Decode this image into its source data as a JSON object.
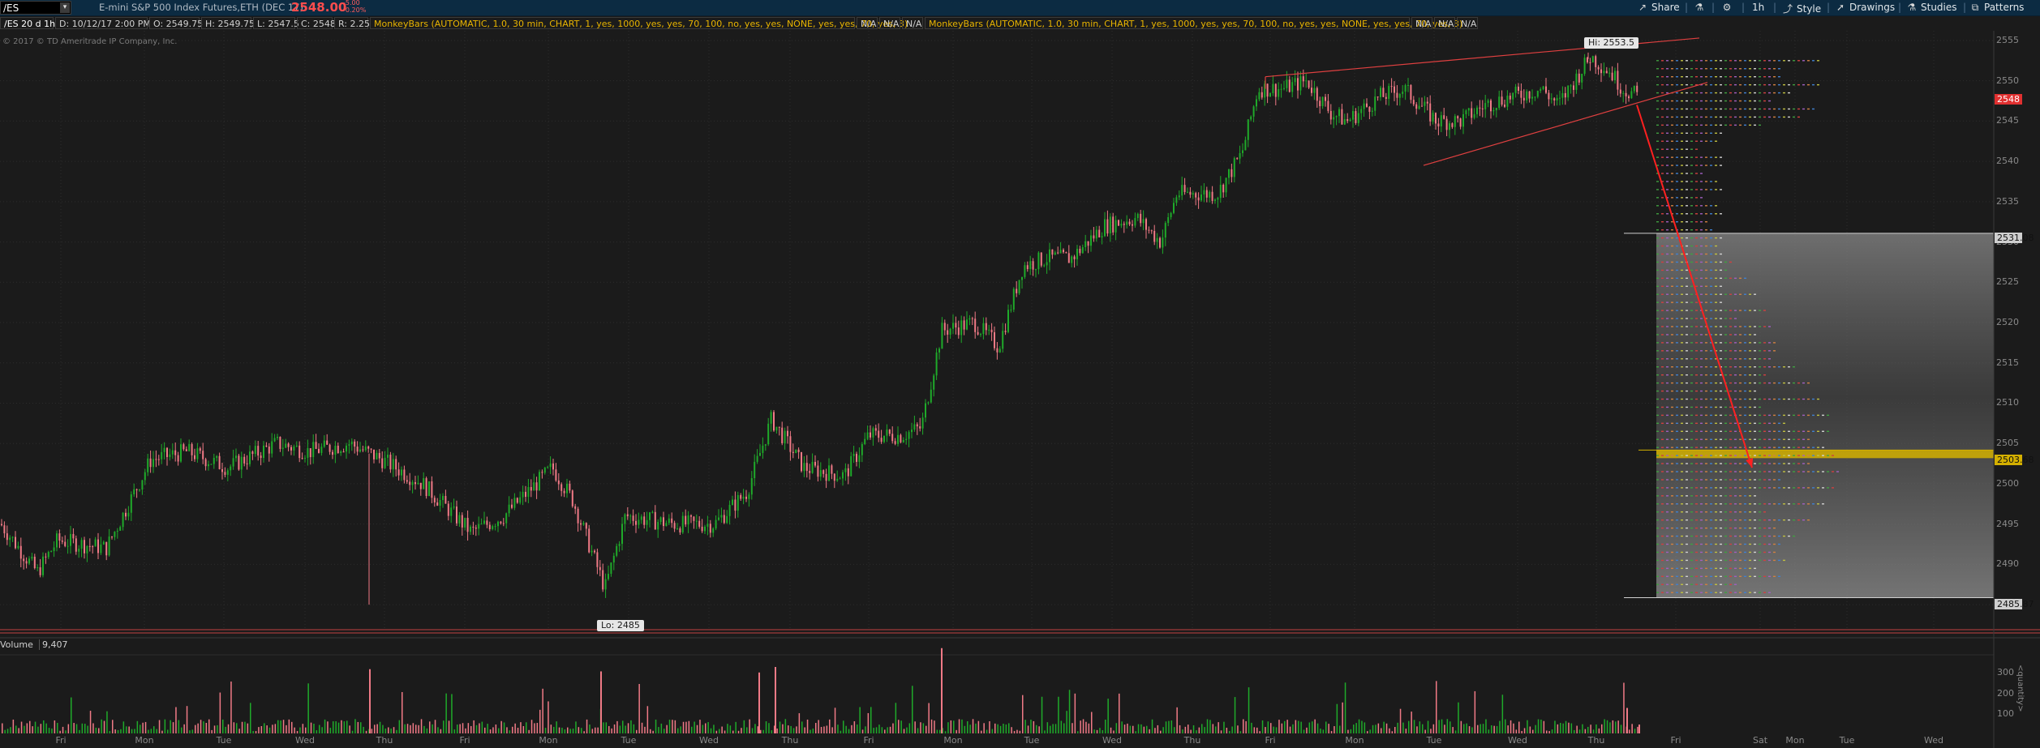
{
  "symbol": {
    "value": "/ES",
    "caret": "▾"
  },
  "header": {
    "description": "E-mini S&P 500 Index Futures,ETH (DEC 17)",
    "last_price": "2548.00",
    "change_line1": "-5.00",
    "change_line2": "-0.20%"
  },
  "toolbar": {
    "share": "Share",
    "flask": "⚗",
    "gear": "⚙",
    "timeframe": "1h",
    "style": "Style",
    "drawings": "Drawings",
    "studies": "Studies",
    "patterns": "Patterns"
  },
  "infobar": {
    "chart_name": "/ES 20 d 1h",
    "date": "D: 10/12/17 2:00 PM",
    "open": "O: 2549.75",
    "high": "H: 2549.75",
    "low": "L: 2547.5",
    "close": "C: 2548",
    "range": "R: 2.25",
    "monkey1": "MonkeyBars (AUTOMATIC, 1.0, 30 min, CHART, 1, yes, 1000, yes, yes, 70, 100, no, yes, yes, NONE, yes, yes, 70, yes, 3)",
    "na1": "N/A",
    "na2": "N/A",
    "na3": "N/A",
    "monkey2": "MonkeyBars (AUTOMATIC, 1.0, 30 min, CHART, 1, yes, 1000, yes, yes, 70, 100, no, yes, yes, NONE, yes, yes, 70, yes, 3)",
    "na4": "N/A",
    "na5": "N/A",
    "na6": "N/A"
  },
  "copyright": "© 2017 © TD Ameritrade IP Company, Inc.",
  "annotations": {
    "high": "Hi: 2553.5",
    "low": "Lo: 2485"
  },
  "price_tags": {
    "current": "2548",
    "upper_level": "2531.08",
    "poc_level": "2503.68",
    "lower_level": "2485.87"
  },
  "colors": {
    "up": "#1faa2a",
    "down": "#f07a86",
    "trendline": "#e04040",
    "arrow": "#ff2020",
    "poc_band": "#d4b000",
    "background": "#1b1b1b",
    "grid": "#2c2c2c"
  },
  "volume": {
    "label": "Volume",
    "value": "9,407",
    "side_label": "<quantity>",
    "axis": [
      "300",
      "200",
      "100"
    ]
  },
  "chart_data": {
    "type": "candlestick",
    "ylim": [
      2483,
      2556
    ],
    "y_ticks": [
      2485,
      2490,
      2495,
      2500,
      2505,
      2510,
      2515,
      2520,
      2525,
      2530,
      2535,
      2540,
      2545,
      2550,
      2555
    ],
    "x_tick_labels": [
      "Fri",
      "Mon",
      "Tue",
      "Wed",
      "Thu",
      "Fri",
      "Mon",
      "Tue",
      "Wed",
      "Thu",
      "Fri",
      "Mon",
      "Tue",
      "Wed",
      "Thu",
      "Fri",
      "Mon",
      "Tue",
      "Wed",
      "Thu",
      "Fri",
      "Sat",
      "Mon",
      "Tue",
      "Wed"
    ],
    "price_path": [
      [
        0,
        2495
      ],
      [
        45,
        2489
      ],
      [
        70,
        2493
      ],
      [
        130,
        2492
      ],
      [
        185,
        2503
      ],
      [
        230,
        2504
      ],
      [
        280,
        2502
      ],
      [
        340,
        2505
      ],
      [
        380,
        2504
      ],
      [
        430,
        2505
      ],
      [
        470,
        2503
      ],
      [
        520,
        2500
      ],
      [
        580,
        2494
      ],
      [
        620,
        2496
      ],
      [
        680,
        2502
      ],
      [
        705,
        2498
      ],
      [
        745,
        2487
      ],
      [
        770,
        2496
      ],
      [
        830,
        2495
      ],
      [
        880,
        2495
      ],
      [
        920,
        2499
      ],
      [
        950,
        2508
      ],
      [
        990,
        2502
      ],
      [
        1040,
        2501
      ],
      [
        1070,
        2506
      ],
      [
        1110,
        2506
      ],
      [
        1135,
        2507
      ],
      [
        1160,
        2519
      ],
      [
        1200,
        2520
      ],
      [
        1230,
        2517
      ],
      [
        1260,
        2527
      ],
      [
        1290,
        2528
      ],
      [
        1320,
        2528
      ],
      [
        1360,
        2532
      ],
      [
        1400,
        2533
      ],
      [
        1430,
        2530
      ],
      [
        1450,
        2536
      ],
      [
        1500,
        2536
      ],
      [
        1530,
        2541
      ],
      [
        1550,
        2549
      ],
      [
        1580,
        2549
      ],
      [
        1610,
        2550
      ],
      [
        1640,
        2546
      ],
      [
        1660,
        2545
      ],
      [
        1700,
        2548
      ],
      [
        1730,
        2549
      ],
      [
        1750,
        2547
      ],
      [
        1770,
        2545
      ],
      [
        1800,
        2545
      ],
      [
        1830,
        2547
      ],
      [
        1860,
        2548
      ],
      [
        1900,
        2549
      ],
      [
        1920,
        2547
      ],
      [
        1940,
        2550
      ],
      [
        1960,
        2553
      ],
      [
        1985,
        2551
      ],
      [
        2000,
        2549
      ],
      [
        2020,
        2548
      ]
    ],
    "volume_spikes": [
      [
        455,
        290
      ],
      [
        740,
        280
      ],
      [
        935,
        275
      ],
      [
        955,
        300
      ],
      [
        1160,
        385
      ],
      [
        2005,
        115
      ],
      [
        2020,
        40
      ]
    ],
    "trendlines": [
      {
        "from": [
          1560,
          2550.5
        ],
        "to": [
          2095,
          2555.3
        ]
      },
      {
        "from": [
          1755,
          2539.5
        ],
        "to": [
          2105,
          2549.8
        ]
      },
      {
        "from": [
          1560,
          2550.5
        ],
        "to": [
          1560,
          2549
        ]
      }
    ],
    "arrow": {
      "from": [
        2018,
        2547
      ],
      "to": [
        2160,
        2502
      ]
    },
    "profile": {
      "x_start": 2042,
      "x_end": 2458,
      "top": 2531.08,
      "bottom": 2485.87,
      "poc": 2503.68
    }
  }
}
